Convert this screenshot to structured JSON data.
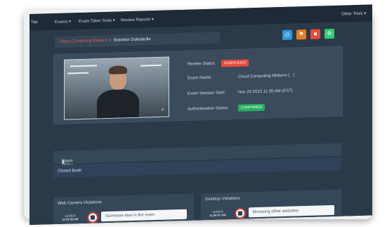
{
  "nav": {
    "brand": "Tap",
    "items": [
      "Exams ▾",
      "Exam Taker Tools ▾",
      "Review Reports ▾"
    ],
    "right": "Other Tools ▾"
  },
  "breadcrumb": {
    "link": "Cloud Computing Midterm",
    "separator": "/",
    "current": "Brandon Doleriaulle"
  },
  "toolbar": {
    "buttons": [
      {
        "icon": "print-icon",
        "glyph": "⎙",
        "color": "#3498db"
      },
      {
        "icon": "flag-icon",
        "glyph": "⚑",
        "color": "#e67e22"
      },
      {
        "icon": "delete-icon",
        "glyph": "■",
        "color": "#e74c3c"
      },
      {
        "icon": "settings-icon",
        "glyph": "⚙",
        "color": "#2ecc71"
      }
    ]
  },
  "details": {
    "review_status_label": "Review Status:",
    "review_status_value": "SUSPICIOUS",
    "exam_name_label": "Exam Name:",
    "exam_name_value": "Cloud Computing Midterm (",
    "exam_name_link": "...",
    "exam_name_close": ")",
    "session_start_label": "Exam Session Start:",
    "session_start_value": "Nov 23 2015 11:30 AM (EST)",
    "auth_label": "Authentication Status:",
    "auth_value": "CONFIRMED"
  },
  "policy": {
    "title": "Exam Policy",
    "value": "Closed Book"
  },
  "webcam_violations": {
    "title": "Web Camera Violations",
    "time_date": "11/23/15",
    "time_clock": "11:06:59 AM",
    "note": "Someone else in the room"
  },
  "desktop_violations": {
    "title": "Desktop Violations",
    "time_date": "11/23/15",
    "time_clock": "11:06:07 AM",
    "note": "Browsing other websites"
  },
  "colors": {
    "suspicious": "#e74c3c",
    "confirmed": "#27ae60",
    "link": "#e55a4e"
  }
}
